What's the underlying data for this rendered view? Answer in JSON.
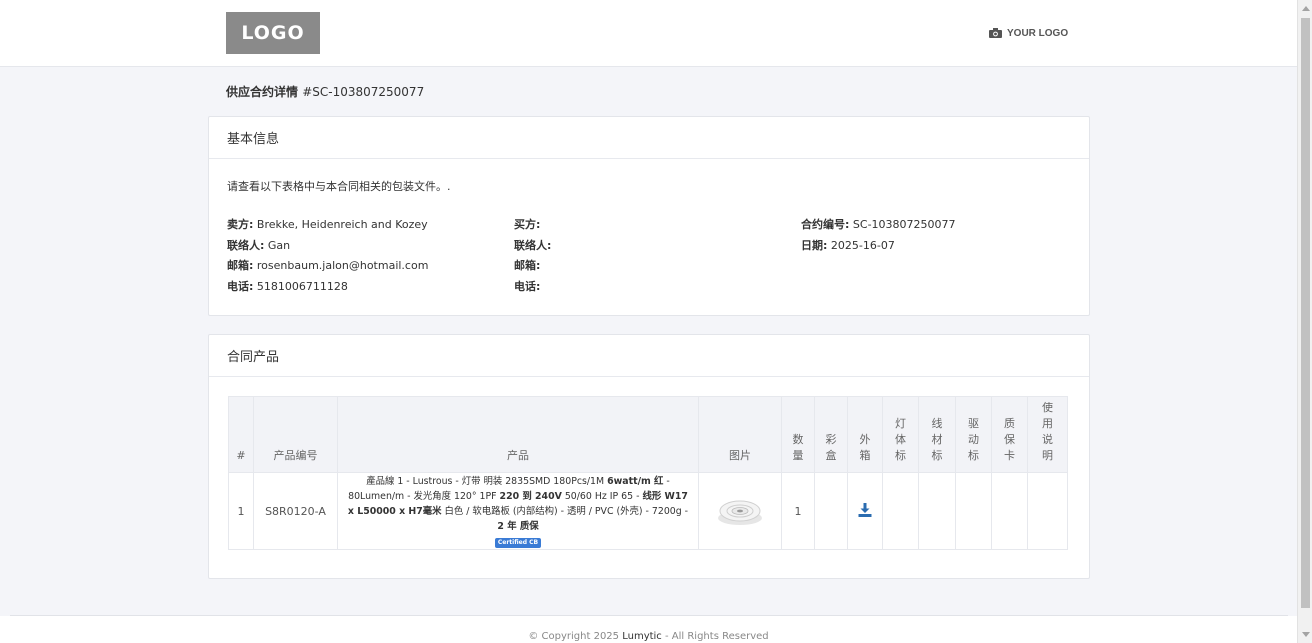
{
  "header": {
    "logo_text": "LOGO",
    "your_logo_text": "YOUR LOGO",
    "your_logo_icon": "camera-icon"
  },
  "page": {
    "title_label": "供应合约详情",
    "title_number": "#SC-103807250077"
  },
  "basic_info": {
    "heading": "基本信息",
    "intro": "请查看以下表格中与本合同相关的包装文件。.",
    "seller": {
      "seller_label": "卖方:",
      "seller_value": "Brekke, Heidenreich and Kozey",
      "contact_label": "联络人:",
      "contact_value": "Gan",
      "email_label": "邮箱:",
      "email_value": "rosenbaum.jalon@hotmail.com",
      "phone_label": "电话:",
      "phone_value": "5181006711128"
    },
    "buyer": {
      "buyer_label": "买方:",
      "buyer_value": "",
      "contact_label": "联络人:",
      "contact_value": "",
      "email_label": "邮箱:",
      "email_value": "",
      "phone_label": "电话:",
      "phone_value": ""
    },
    "contract": {
      "number_label": "合约编号:",
      "number_value": "SC-103807250077",
      "date_label": "日期:",
      "date_value": "2025-16-07"
    }
  },
  "products": {
    "heading": "合同产品",
    "columns": [
      "#",
      "产品编号",
      "产品",
      "图片",
      "数量",
      "彩盒",
      "外箱",
      "灯体标",
      "线材标",
      "驱动标",
      "质保卡",
      "使用说明"
    ],
    "rows": [
      {
        "index": "1",
        "code": "S8R0120-A",
        "desc_1": "產品線 1 - Lustrous - 灯带 明装 2835SMD 180Pcs/1M ",
        "desc_1b": "6watt/m 红",
        "desc_2": " - 80Lumen/m - 发光角度 120° 1PF ",
        "desc_2b": "220 到 240V",
        "desc_3": " 50/60 Hz IP 65 - ",
        "desc_3b": "线形 W17 x L50000 x H7毫米",
        "desc_4": " 白色 / 软电路板 (内部结构) - 透明 / PVC (外壳) - 7200g - ",
        "desc_4b": "2 年 质保",
        "badge": "Certified CB",
        "image_icon": "led-strip-reel-image",
        "quantity": "1",
        "outer_box_icon": "download-icon"
      }
    ]
  },
  "footer": {
    "prefix": "© Copyright 2025 ",
    "brand": "Lumytic",
    "suffix": " - All Rights Reserved"
  }
}
